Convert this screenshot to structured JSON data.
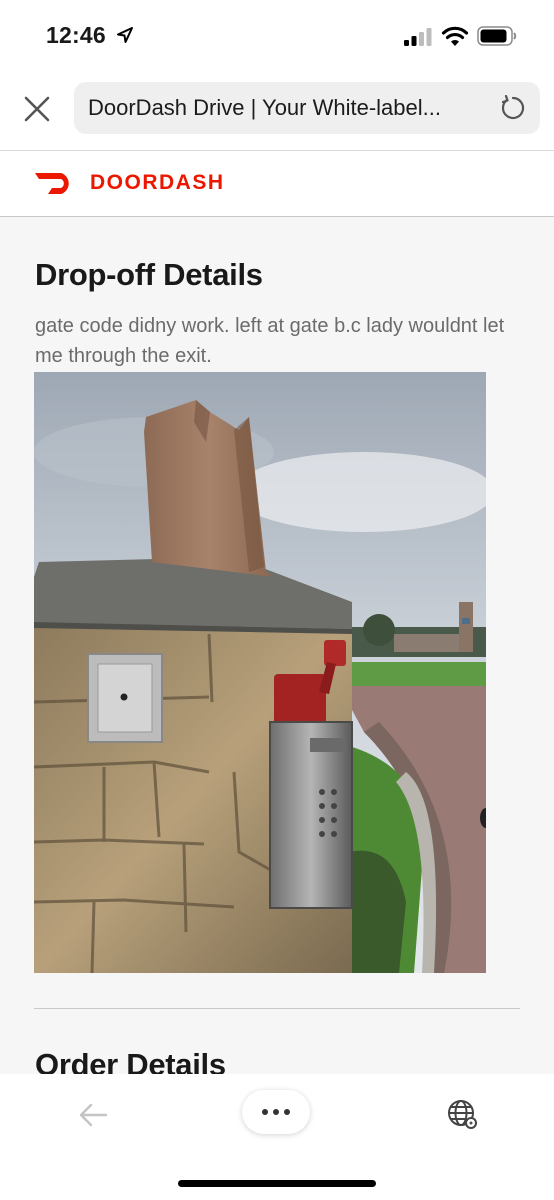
{
  "status_bar": {
    "time": "12:46",
    "icons": [
      "location-arrow-icon",
      "signal-icon",
      "wifi-icon",
      "battery-icon"
    ]
  },
  "browser": {
    "url_title": "DoorDash Drive | Your White-label...",
    "icons": [
      "close-icon",
      "reload-icon"
    ]
  },
  "site": {
    "brand": "DOORDASH",
    "brand_color": "#eb1700",
    "logo_icon": "doordash-dash-logo"
  },
  "dropoff": {
    "title": "Drop-off Details",
    "note": "gate code didny work. left at gate b.c lady wouldnt let me through the exit.",
    "photo": "drop-off photo: paper bag on top of stone gate pillar with keypad"
  },
  "order": {
    "title": "Order Details"
  },
  "toolbar": {
    "icons": [
      "back-arrow-icon",
      "more-dots-icon",
      "globe-icon"
    ]
  }
}
